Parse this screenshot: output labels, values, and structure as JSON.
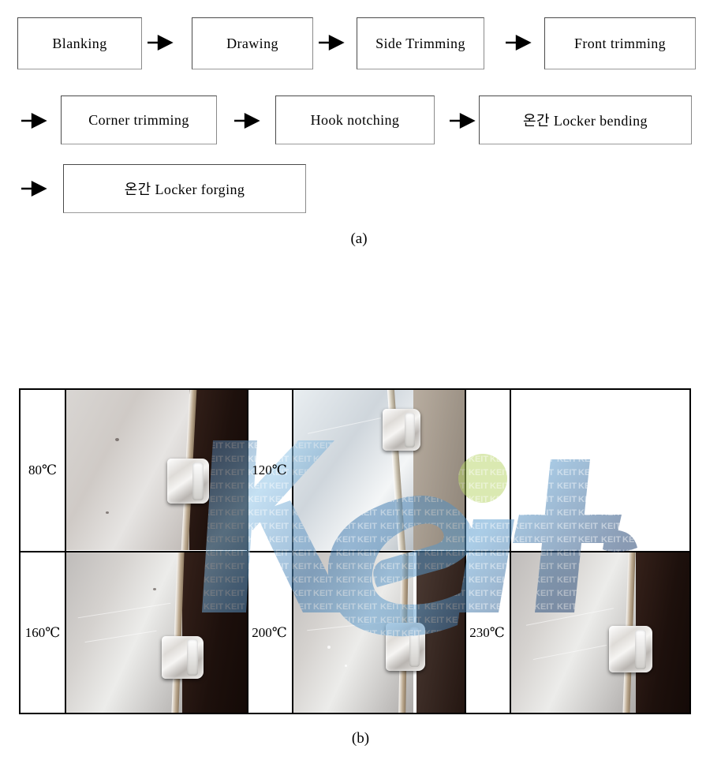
{
  "figure_a": {
    "caption": "(a)",
    "steps": [
      {
        "label": "Blanking",
        "row": 1
      },
      {
        "label": "Drawing",
        "row": 1
      },
      {
        "label": "Side Trimming",
        "row": 1
      },
      {
        "label": "Front trimming",
        "row": 1
      },
      {
        "label": "Corner trimming",
        "row": 2
      },
      {
        "label": "Hook notching",
        "row": 2
      },
      {
        "label": "온간 Locker bending",
        "row": 2
      },
      {
        "label": "온간 Locker forging",
        "row": 3
      }
    ],
    "arrow_icon": "right-arrow-icon"
  },
  "figure_b": {
    "caption": "(b)",
    "watermark_text": "KEIT",
    "watermark_colors": {
      "blue_dark": "#1f3f6e",
      "blue_mid": "#4a82b8",
      "blue_light": "#8fc4e8",
      "green": "#b9d66a"
    },
    "cells": [
      {
        "temperature": "80℃",
        "row": 1,
        "col": 1,
        "has_photo": true
      },
      {
        "temperature": "120℃",
        "row": 1,
        "col": 2,
        "has_photo": true
      },
      {
        "temperature": "",
        "row": 1,
        "col": 3,
        "has_photo": false
      },
      {
        "temperature": "160℃",
        "row": 2,
        "col": 1,
        "has_photo": true
      },
      {
        "temperature": "200℃",
        "row": 2,
        "col": 2,
        "has_photo": true
      },
      {
        "temperature": "230℃",
        "row": 2,
        "col": 3,
        "has_photo": true
      }
    ]
  }
}
